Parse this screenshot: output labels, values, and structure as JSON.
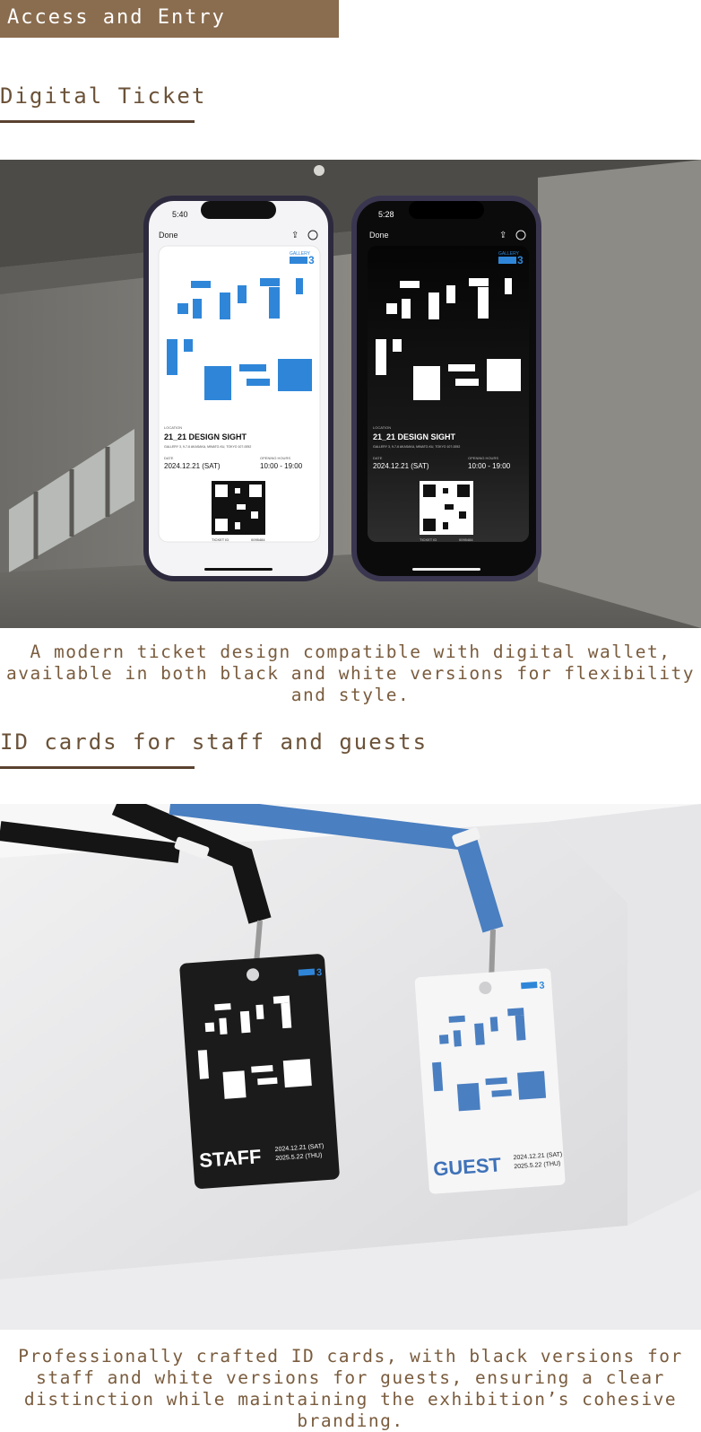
{
  "header": {
    "title": "Access and Entry"
  },
  "sections": [
    {
      "title": "Digital Ticket",
      "caption": "A modern ticket design compatible with digital wallet, available in both black and white versions for flexibility and style."
    },
    {
      "title": "ID cards for staff and guests",
      "caption": "Professionally crafted ID cards, with black versions for staff and white versions for guests, ensuring a clear distinction while maintaining the exhibition’s cohesive branding."
    }
  ],
  "tickets": {
    "phones": [
      {
        "time": "5:40",
        "theme": "white"
      },
      {
        "time": "5:28",
        "theme": "black"
      }
    ],
    "done_label": "Done",
    "gallery_label": "GALLERY",
    "gallery_number": "3",
    "location_label": "LOCATION",
    "location_name": "21_21 DESIGN SIGHT",
    "address": "GALLERY 3, 9-7-6 AKASAKA, MINATO-KU, TOKYO 107-0052",
    "date_label": "DATE",
    "date_value": "2024.12.21 (SAT)",
    "hours_label": "OPENING HOURS",
    "hours_value": "10:00 - 19:00",
    "ticket_id_label": "TICKET ID",
    "ticket_id_value": "0095484"
  },
  "id_cards": {
    "staff": {
      "role": "STAFF",
      "date_start": "2024.12.21 (SAT)",
      "date_end": "2025.5.22 (THU)"
    },
    "guest": {
      "role": "GUEST",
      "date_start": "2024.12.21 (SAT)",
      "date_end": "2025.5.22 (THU)"
    }
  },
  "colors": {
    "brand_brown": "#8a6c4e",
    "accent_blue": "#2f86d8",
    "lanyard_blue": "#4a7fc1"
  }
}
